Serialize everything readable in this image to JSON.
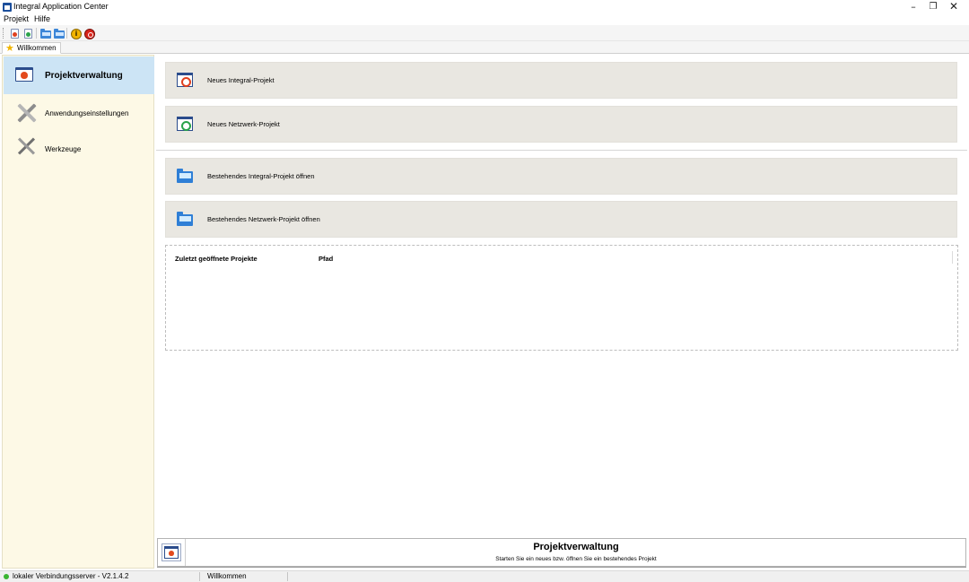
{
  "window": {
    "title": "Integral Application Center",
    "controls": {
      "minimize": "–",
      "maximize": "❐",
      "close": "✕"
    }
  },
  "menu": [
    "Projekt",
    "Hilfe"
  ],
  "toolbar": {
    "icons": [
      "new-integral-project-icon",
      "new-network-project-icon",
      "open-integral-project-icon",
      "open-network-project-icon",
      "info-icon",
      "exit-icon"
    ]
  },
  "tabs": [
    {
      "label": "Willkommen",
      "icon": "star-icon"
    }
  ],
  "sidebar": {
    "items": [
      {
        "label": "Projektverwaltung",
        "icon": "project-icon",
        "active": true
      },
      {
        "label": "Anwendungseinstellungen",
        "icon": "tools-icon",
        "active": false
      },
      {
        "label": "Werkzeuge",
        "icon": "hammer-icon",
        "active": false
      }
    ]
  },
  "main": {
    "actions": [
      {
        "label": "Neues Integral-Projekt",
        "icon": "new-integral-project-icon"
      },
      {
        "label": "Neues Netzwerk-Projekt",
        "icon": "new-network-project-icon"
      },
      {
        "label": "Bestehendes Integral-Projekt öffnen",
        "icon": "open-folder-icon"
      },
      {
        "label": "Bestehendes Netzwerk-Projekt öffnen",
        "icon": "open-folder-icon"
      }
    ],
    "recent": {
      "columns": [
        "Zuletzt geöffnete Projekte",
        "Pfad"
      ],
      "rows": []
    }
  },
  "info": {
    "title": "Projektverwaltung",
    "subtitle": "Starten Sie ein neues bzw. öffnen Sie ein bestehendes Projekt"
  },
  "status": {
    "server": "lokaler Verbindungsserver - V2.1.4.2",
    "page": "Willkommen",
    "server_color": "#3ab531"
  }
}
